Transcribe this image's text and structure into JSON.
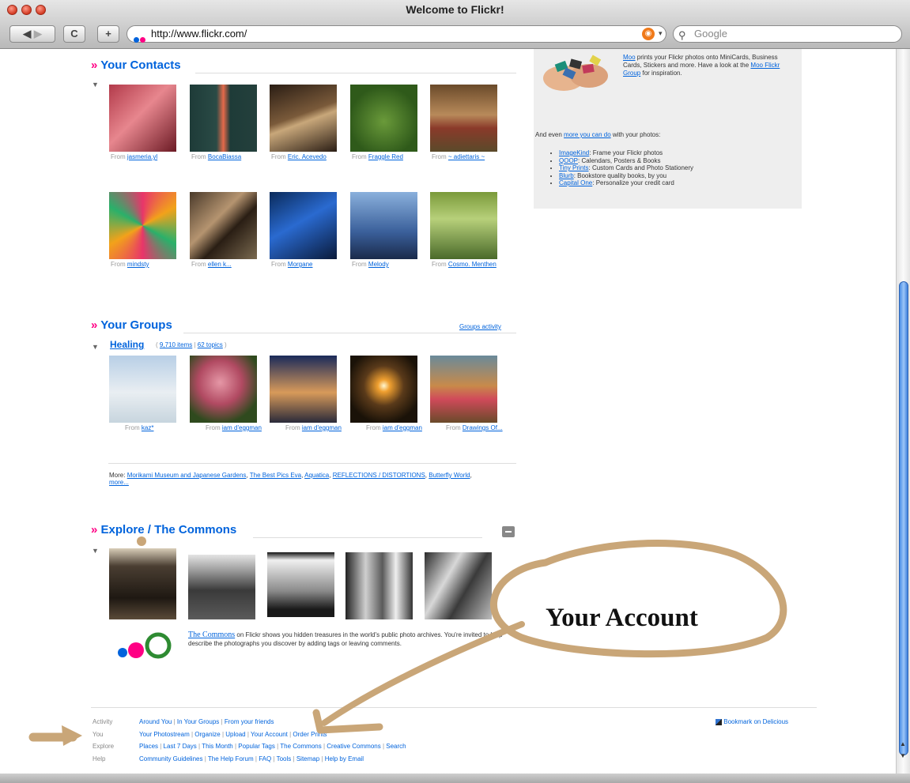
{
  "window": {
    "title": "Welcome to Flickr!"
  },
  "toolbar": {
    "url": "http://www.flickr.com/",
    "search_placeholder": "Google",
    "reload_label": "C",
    "add_label": "+"
  },
  "contacts": {
    "title": "Your Contacts",
    "items": [
      {
        "from": "From",
        "user": "jasmeria.yl"
      },
      {
        "from": "From",
        "user": "BocaBiassa"
      },
      {
        "from": "From",
        "user": "Eric. Acevedo"
      },
      {
        "from": "From",
        "user": "Fraggle Red"
      },
      {
        "from": "From",
        "user": "~ adiettaris ~"
      },
      {
        "from": "From",
        "user": "mindsty"
      },
      {
        "from": "From",
        "user": "ellen k..."
      },
      {
        "from": "From",
        "user": "Morgane"
      },
      {
        "from": "From",
        "user": "Melody"
      },
      {
        "from": "From",
        "user": "Cosmo. Menthen"
      }
    ]
  },
  "groups": {
    "title": "Your Groups",
    "activity_link": "Groups activity",
    "group_name": "Healing",
    "group_items": "9,710 items",
    "group_topics": "62 topics",
    "items": [
      {
        "from": "From",
        "user": "kaz*"
      },
      {
        "from": "From",
        "user": "iam d'eggman"
      },
      {
        "from": "From",
        "user": "iam d'eggman"
      },
      {
        "from": "From",
        "user": "iam d'eggman"
      },
      {
        "from": "From",
        "user": "Drawings Of..."
      }
    ],
    "more_label": "More:",
    "more_links": [
      "Morikami Museum and Japanese Gardens",
      "The Best Pics Eva",
      "Aquatica",
      "REFLECTIONS / DISTORTIONS",
      "Butterfly World",
      "more..."
    ]
  },
  "explore": {
    "title_a": "Explore",
    "title_sep": " / ",
    "title_b": "The Commons",
    "commons_link": "The Commons",
    "commons_text": "on Flickr shows you hidden treasures in the world's public photo archives. You're invited to help describe the photographs you discover by adding tags or leaving comments."
  },
  "moo": {
    "link": "Moo",
    "text": "prints your Flickr photos onto MiniCards, Business Cards, Stickers and more. Have a look at the",
    "group_link": "Moo Flickr Group",
    "tail": "for inspiration.",
    "more_prefix": "And even",
    "more_link": "more you can do",
    "more_suffix": "with your photos:",
    "list": [
      {
        "link": "ImageKind",
        "text": ": Frame your Flickr photos"
      },
      {
        "link": "QOOP",
        "text": ": Calendars, Posters & Books"
      },
      {
        "link": "Tiny Prints",
        "text": ": Custom Cards and Photo Stationery"
      },
      {
        "link": "Blurb",
        "text": ": Bookstore quality books, by you"
      },
      {
        "link": "Capital One",
        "text": ": Personalize your credit card"
      }
    ]
  },
  "footer": {
    "rows": [
      {
        "label": "Activity",
        "links": [
          "Around You",
          "In Your Groups",
          "From your friends"
        ]
      },
      {
        "label": "You",
        "links": [
          "Your Photostream",
          "Organize",
          "Upload",
          "Your Account",
          "Order Prints"
        ]
      },
      {
        "label": "Explore",
        "links": [
          "Places",
          "Last 7 Days",
          "This Month",
          "Popular Tags",
          "The Commons",
          "Creative Commons",
          "Search"
        ]
      },
      {
        "label": "Help",
        "links": [
          "Community Guidelines",
          "The Help Forum",
          "FAQ",
          "Tools",
          "Sitemap",
          "Help by Email"
        ]
      }
    ],
    "bookmark": "Bookmark on Delicious"
  },
  "annotation": {
    "text": "Your Account"
  }
}
